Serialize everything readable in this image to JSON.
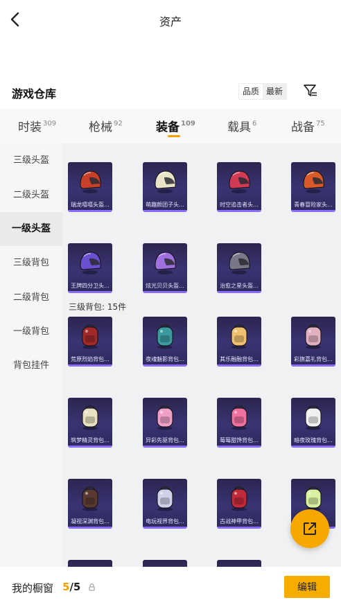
{
  "header": {
    "title": "资产"
  },
  "section": {
    "title": "游戏仓库"
  },
  "sort": {
    "options": [
      "品质",
      "最新"
    ],
    "active": 1
  },
  "tabs": [
    {
      "label": "时装",
      "count": "309"
    },
    {
      "label": "枪械",
      "count": "92"
    },
    {
      "label": "装备",
      "count": "109",
      "active": true
    },
    {
      "label": "载具",
      "count": "6"
    },
    {
      "label": "战备",
      "count": "75"
    }
  ],
  "sidebar": {
    "items": [
      {
        "label": "三级头盔"
      },
      {
        "label": "二级头盔"
      },
      {
        "label": "一级头盔",
        "active": true
      },
      {
        "label": "三级背包"
      },
      {
        "label": "二级背包"
      },
      {
        "label": "一级背包"
      },
      {
        "label": "背包挂件"
      }
    ]
  },
  "helmets": [
    {
      "label": "瑞龙嘻嘻头盔...",
      "color": "#c8402a"
    },
    {
      "label": "萌趣颜团子头...",
      "color": "#e9e4c8"
    },
    {
      "label": "时空追击者头...",
      "color": "#d23a55"
    },
    {
      "label": "青春冒险家头...",
      "color": "#d85a2a"
    },
    {
      "label": "王牌四分卫头...",
      "color": "#6a4fd0"
    },
    {
      "label": "炫光贝贝头盔...",
      "color": "#a070e0"
    },
    {
      "label": "治愈之星头盔...",
      "color": "#777788"
    }
  ],
  "backpack_group": {
    "label": "三级背包: 15件"
  },
  "backpacks": [
    {
      "label": "荒原烈焰背包...",
      "color": "#a02a2a"
    },
    {
      "label": "夜魂魅影背包...",
      "color": "#3a9aa0"
    },
    {
      "label": "其乐融融背包...",
      "color": "#f0c070"
    },
    {
      "label": "彩旗嘉礼背包...",
      "color": "#e0b0c0"
    },
    {
      "label": "筑梦精灵背包...",
      "color": "#e8e0c0"
    },
    {
      "label": "异彩先驱背包...",
      "color": "#f0a0c8"
    },
    {
      "label": "莓莓甜馋背包...",
      "color": "#f070a0"
    },
    {
      "label": "暗夜玫瑰背包...",
      "color": "#f0f0f0"
    },
    {
      "label": "凝视深渊背包...",
      "color": "#5a3a30"
    },
    {
      "label": "电玩视界背包...",
      "color": "#d0d0e8"
    },
    {
      "label": "古战神甲背包...",
      "color": "#c02a3a"
    },
    {
      "label": "",
      "color": "#d8f0a0"
    },
    {
      "label": "",
      "color": "#555566"
    },
    {
      "label": "",
      "color": "#555566"
    },
    {
      "label": "",
      "color": "#555566"
    }
  ],
  "bottom": {
    "label": "我的橱窗",
    "used": "5",
    "slash_total": "/5",
    "edit_label": "编辑"
  },
  "colors": {
    "accent": "#f5a200",
    "card_border": "#8a6cff"
  }
}
